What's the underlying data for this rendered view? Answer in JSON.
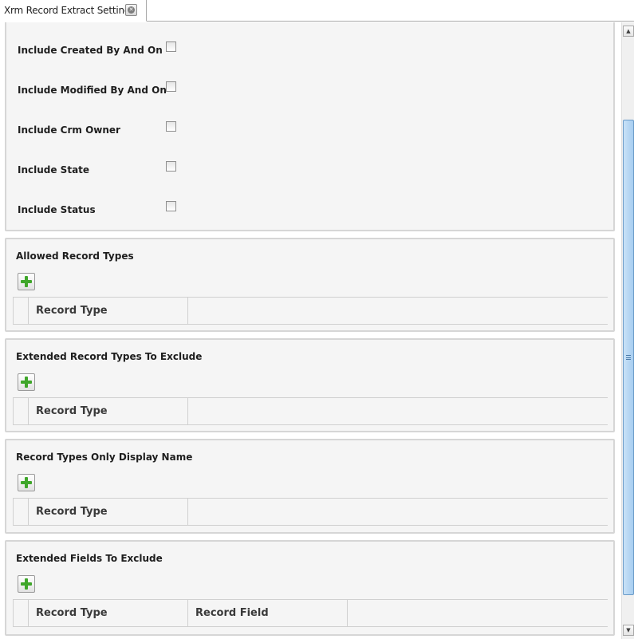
{
  "tab": {
    "title": "Xrm Record Extract Settings",
    "close_icon": "close-icon"
  },
  "checkbox_section": {
    "items": [
      {
        "label": "Include Created By And On",
        "checked": false
      },
      {
        "label": "Include Modified By And On",
        "checked": false
      },
      {
        "label": "Include Crm Owner",
        "checked": false
      },
      {
        "label": "Include State",
        "checked": false
      },
      {
        "label": "Include Status",
        "checked": false
      }
    ]
  },
  "sections": [
    {
      "title": "Allowed Record Types",
      "add_icon": "plus-icon",
      "columns": [
        "Record Type"
      ],
      "rows": []
    },
    {
      "title": "Extended Record Types To Exclude",
      "add_icon": "plus-icon",
      "columns": [
        "Record Type"
      ],
      "rows": []
    },
    {
      "title": "Record Types Only Display Name",
      "add_icon": "plus-icon",
      "columns": [
        "Record Type"
      ],
      "rows": []
    },
    {
      "title": "Extended Fields To Exclude",
      "add_icon": "plus-icon",
      "columns": [
        "Record Type",
        "Record Field"
      ],
      "rows": []
    }
  ],
  "colors": {
    "panel_background": "#f5f5f5",
    "panel_border": "#d6d6d6",
    "add_icon": "#3fa62a",
    "scroll_thumb": "#a7cdf0"
  }
}
